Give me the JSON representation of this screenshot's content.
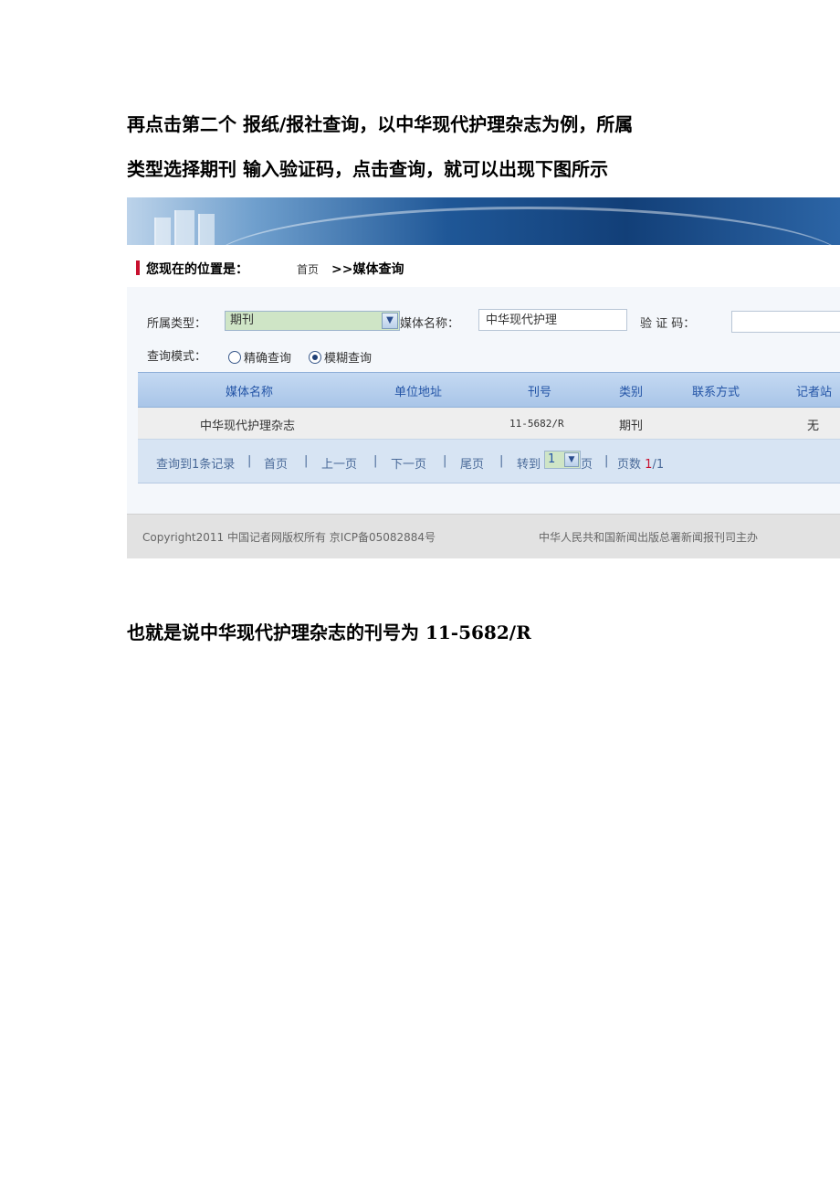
{
  "doc": {
    "para1": "再点击第二个  报纸/报社查询，以中华现代护理杂志为例，所属",
    "para2": "类型选择期刊  输入验证码，点击查询，就可以出现下图所示",
    "para3": "也就是说中华现代护理杂志的刊号为 11-5682/R"
  },
  "screenshot": {
    "breadcrumb": {
      "label": "您现在的位置是：",
      "home": "首页",
      "current": ">>媒体查询"
    },
    "form": {
      "type_label": "所属类型：",
      "type_value": "期刊",
      "name_label": "媒体名称：",
      "name_value": "中华现代护理",
      "captcha_label": "验  证  码：",
      "captcha_value": "",
      "mode_label": "查询模式：",
      "mode_exact": "精确查询",
      "mode_fuzzy": "模糊查询",
      "mode_selected": "模糊查询"
    },
    "table": {
      "headers": [
        "媒体名称",
        "单位地址",
        "刊号",
        "类别",
        "联系方式",
        "记者站"
      ],
      "rows": [
        [
          "中华现代护理杂志",
          "",
          "11-5682/R",
          "期刊",
          "",
          "无"
        ]
      ]
    },
    "pager": {
      "records": "查询到1条记录",
      "sep": "|",
      "first": "首页",
      "prev": "上一页",
      "next": "下一页",
      "last": "尾页",
      "goto_label": "转到",
      "goto_value": "1",
      "page_suffix": "页",
      "pages_label": "页数",
      "pages_current": "1",
      "pages_total": "/1"
    },
    "footer": {
      "copyright": "Copyright2011  中国记者网版权所有  京ICP备05082884号",
      "org": "中华人民共和国新闻出版总署新闻报刊司主办"
    }
  },
  "colors": {
    "banner_dark": "#123f78",
    "table_header_text": "#2354a6",
    "accent_red": "#c8102e",
    "select_bg": "#cfe5c6"
  }
}
